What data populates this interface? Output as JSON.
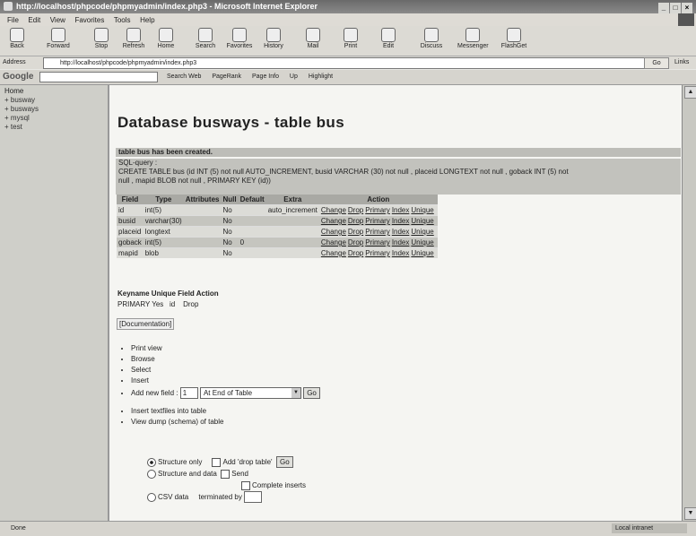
{
  "window": {
    "title": "http://localhost/phpcode/phpmyadmin/index.php3 - Microsoft Internet Explorer",
    "controls": [
      "_",
      "□",
      "×"
    ]
  },
  "menu": [
    "File",
    "Edit",
    "View",
    "Favorites",
    "Tools",
    "Help"
  ],
  "toolbar": {
    "buttons": [
      "Back",
      "Forward",
      "Stop",
      "Refresh",
      "Home",
      "Search",
      "Favorites",
      "History",
      "Mail",
      "Print",
      "Edit",
      "Discuss",
      "Messenger",
      "FlashGet"
    ]
  },
  "address": {
    "label": "Address",
    "url": "http://localhost/phpcode/phpmyadmin/index.php3",
    "go": "Go",
    "links": "Links"
  },
  "googlebar": {
    "logo": "Google",
    "items": [
      "Search Web",
      "PageRank",
      "Page Info",
      "Up",
      "Highlight"
    ]
  },
  "left": {
    "home": "Home",
    "databases": [
      "busway",
      "busways",
      "mysql",
      "test"
    ]
  },
  "main": {
    "title": "Database busways - table bus",
    "created_msg": "table bus has been created.",
    "sql_label": "SQL-query :",
    "sql_query_1": "CREATE TABLE bus (id INT (5) not null AUTO_INCREMENT, busid VARCHAR (30) not null , placeid LONGTEXT not null , goback INT (5) not",
    "sql_query_2": "null , mapid BLOB not null , PRIMARY KEY (id))",
    "columns": [
      "Field",
      "Type",
      "Attributes",
      "Null",
      "Default",
      "Extra",
      "Action"
    ],
    "rows": [
      {
        "field": "id",
        "type": "int(5)",
        "attributes": "",
        "null": "No",
        "default": "",
        "extra": "auto_increment"
      },
      {
        "field": "busid",
        "type": "varchar(30)",
        "attributes": "",
        "null": "No",
        "default": "",
        "extra": ""
      },
      {
        "field": "placeid",
        "type": "longtext",
        "attributes": "",
        "null": "No",
        "default": "",
        "extra": ""
      },
      {
        "field": "goback",
        "type": "int(5)",
        "attributes": "",
        "null": "No",
        "default": "0",
        "extra": ""
      },
      {
        "field": "mapid",
        "type": "blob",
        "attributes": "",
        "null": "No",
        "default": "",
        "extra": ""
      }
    ],
    "actions": [
      "Change",
      "Drop",
      "Primary",
      "Index",
      "Unique"
    ],
    "keys_header": "Keyname Unique Field Action",
    "key_row": {
      "keyname": "PRIMARY",
      "unique": "Yes",
      "field": "id",
      "action": "Drop"
    },
    "documentation": "[Documentation]",
    "ops": [
      "Print view",
      "Browse",
      "Select",
      "Insert"
    ],
    "add_field": {
      "label": "Add new field :",
      "count": "1",
      "position": "At End of Table",
      "go": "Go"
    },
    "insert_textfile": "Insert textfiles into table",
    "view_dump": "View dump (schema) of table",
    "structure_only": "Structure only",
    "add_drop": "Add 'drop table'",
    "dump_go": "Go",
    "structure_data": "Structure and data",
    "send": "Send",
    "complete_inserts": "Complete inserts",
    "csv": "CSV data",
    "terminated": "terminated by"
  },
  "status": {
    "text": "Done",
    "zone": "Local intranet"
  }
}
